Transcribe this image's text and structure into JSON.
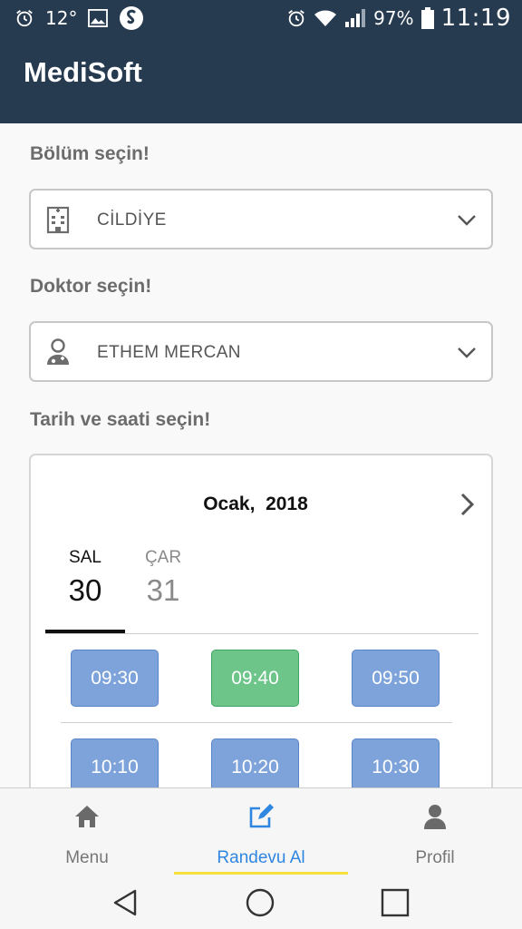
{
  "status_bar": {
    "temperature": "12°",
    "battery": "97%",
    "time": "11:19"
  },
  "app": {
    "title": "MediSoft"
  },
  "department": {
    "label": "Bölüm seçin!",
    "selected": "CİLDİYE",
    "icon": "hospital-building-icon"
  },
  "doctor": {
    "label": "Doktor seçin!",
    "selected": "ETHEM MERCAN",
    "icon": "doctor-icon"
  },
  "datetime": {
    "label": "Tarih ve saati seçin!",
    "month": "Ocak,  2018",
    "days": [
      {
        "dow": "SAL",
        "num": "30",
        "active": true
      },
      {
        "dow": "ÇAR",
        "num": "31",
        "active": false
      }
    ],
    "slots": [
      {
        "time": "09:30",
        "state": "available"
      },
      {
        "time": "09:40",
        "state": "selected"
      },
      {
        "time": "09:50",
        "state": "available"
      },
      {
        "time": "10:10",
        "state": "available"
      },
      {
        "time": "10:20",
        "state": "available"
      },
      {
        "time": "10:30",
        "state": "available"
      }
    ]
  },
  "bottom_nav": {
    "items": [
      {
        "label": "Menu",
        "icon": "home-icon",
        "active": false
      },
      {
        "label": "Randevu Al",
        "icon": "edit-icon",
        "active": true
      },
      {
        "label": "Profil",
        "icon": "user-icon",
        "active": false
      }
    ]
  },
  "colors": {
    "app_bar": "#263a50",
    "slot_available": "#7da3da",
    "slot_selected": "#6dc58a",
    "nav_active": "#2f86e0",
    "nav_indicator": "#f5e13a"
  }
}
